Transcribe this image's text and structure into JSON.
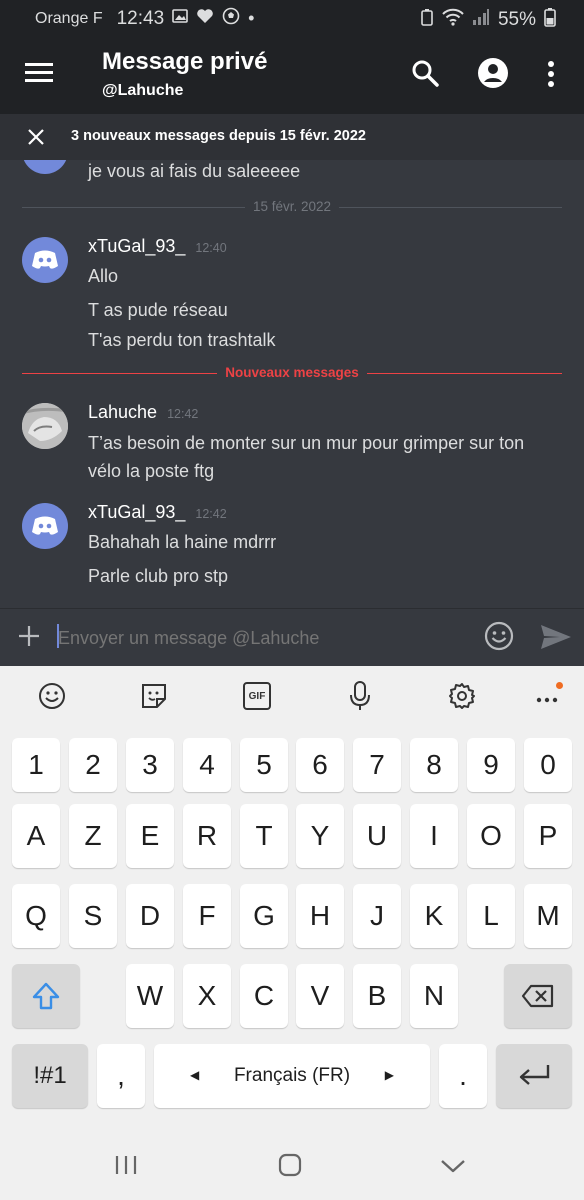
{
  "status": {
    "carrier": "Orange F",
    "time": "12:43",
    "battery": "55%"
  },
  "appbar": {
    "title": "Message privé",
    "subtitle": "@Lahuche"
  },
  "banner": {
    "text": "3 nouveaux messages depuis 15 févr. 2022"
  },
  "messages": {
    "prev_text": "je vous ai fais du saleeeee",
    "date_divider": "15 févr. 2022",
    "group1": {
      "user": "xTuGal_93_",
      "time": "12:40",
      "lines": [
        "Allo",
        "T as pude réseau",
        "T'as perdu  ton trashtalk"
      ]
    },
    "new_divider": "Nouveaux messages",
    "group2": {
      "user": "Lahuche",
      "time": "12:42",
      "lines": [
        "T’as besoin de monter sur un mur pour grimper sur ton",
        "vélo la poste ftg"
      ]
    },
    "group3": {
      "user": "xTuGal_93_",
      "time": "12:42",
      "lines": [
        "Bahahah la haine mdrrr",
        "Parle club pro stp"
      ]
    }
  },
  "composer": {
    "placeholder": "Envoyer un message @Lahuche"
  },
  "keyboard": {
    "toolbar_gif": "GIF",
    "row_numbers": [
      "1",
      "2",
      "3",
      "4",
      "5",
      "6",
      "7",
      "8",
      "9",
      "0"
    ],
    "row1": [
      "A",
      "Z",
      "E",
      "R",
      "T",
      "Y",
      "U",
      "I",
      "O",
      "P"
    ],
    "row2": [
      "Q",
      "S",
      "D",
      "F",
      "G",
      "H",
      "J",
      "K",
      "L",
      "M"
    ],
    "row3": [
      "W",
      "X",
      "C",
      "V",
      "B",
      "N"
    ],
    "symbols": "!#1",
    "comma": ",",
    "language": "Français (FR)",
    "period": "."
  },
  "colors": {
    "accent": "#7289da",
    "new_messages": "#ed4245",
    "keyboard_bg": "#f0f0f0"
  }
}
